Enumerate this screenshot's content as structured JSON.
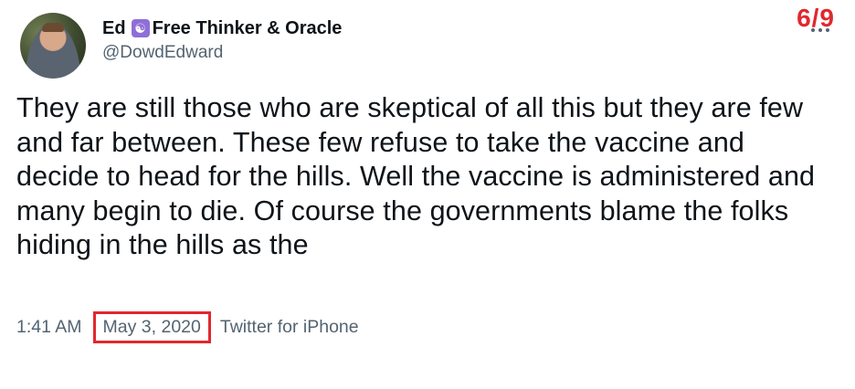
{
  "tweet": {
    "display_name": "Ed",
    "name_badge_emoji": "☯",
    "name_suffix": "Free Thinker & Oracle",
    "handle": "@DowdEdward",
    "counter": "6/9",
    "text": "They are still those who are skeptical of all this but they are few and far between. These few refuse to take the vaccine and decide to head for the hills. Well the vaccine is administered and many begin to die. Of course the governments blame the folks hiding in the hills as the",
    "time": "1:41 AM",
    "date": "May 3, 2020",
    "source": "Twitter for iPhone",
    "more_icon": "more-horizontal-icon"
  },
  "colors": {
    "highlight": "#e0282e",
    "secondary_text": "#536471",
    "primary_text": "#0f1419",
    "badge": "#8e6fd8"
  }
}
